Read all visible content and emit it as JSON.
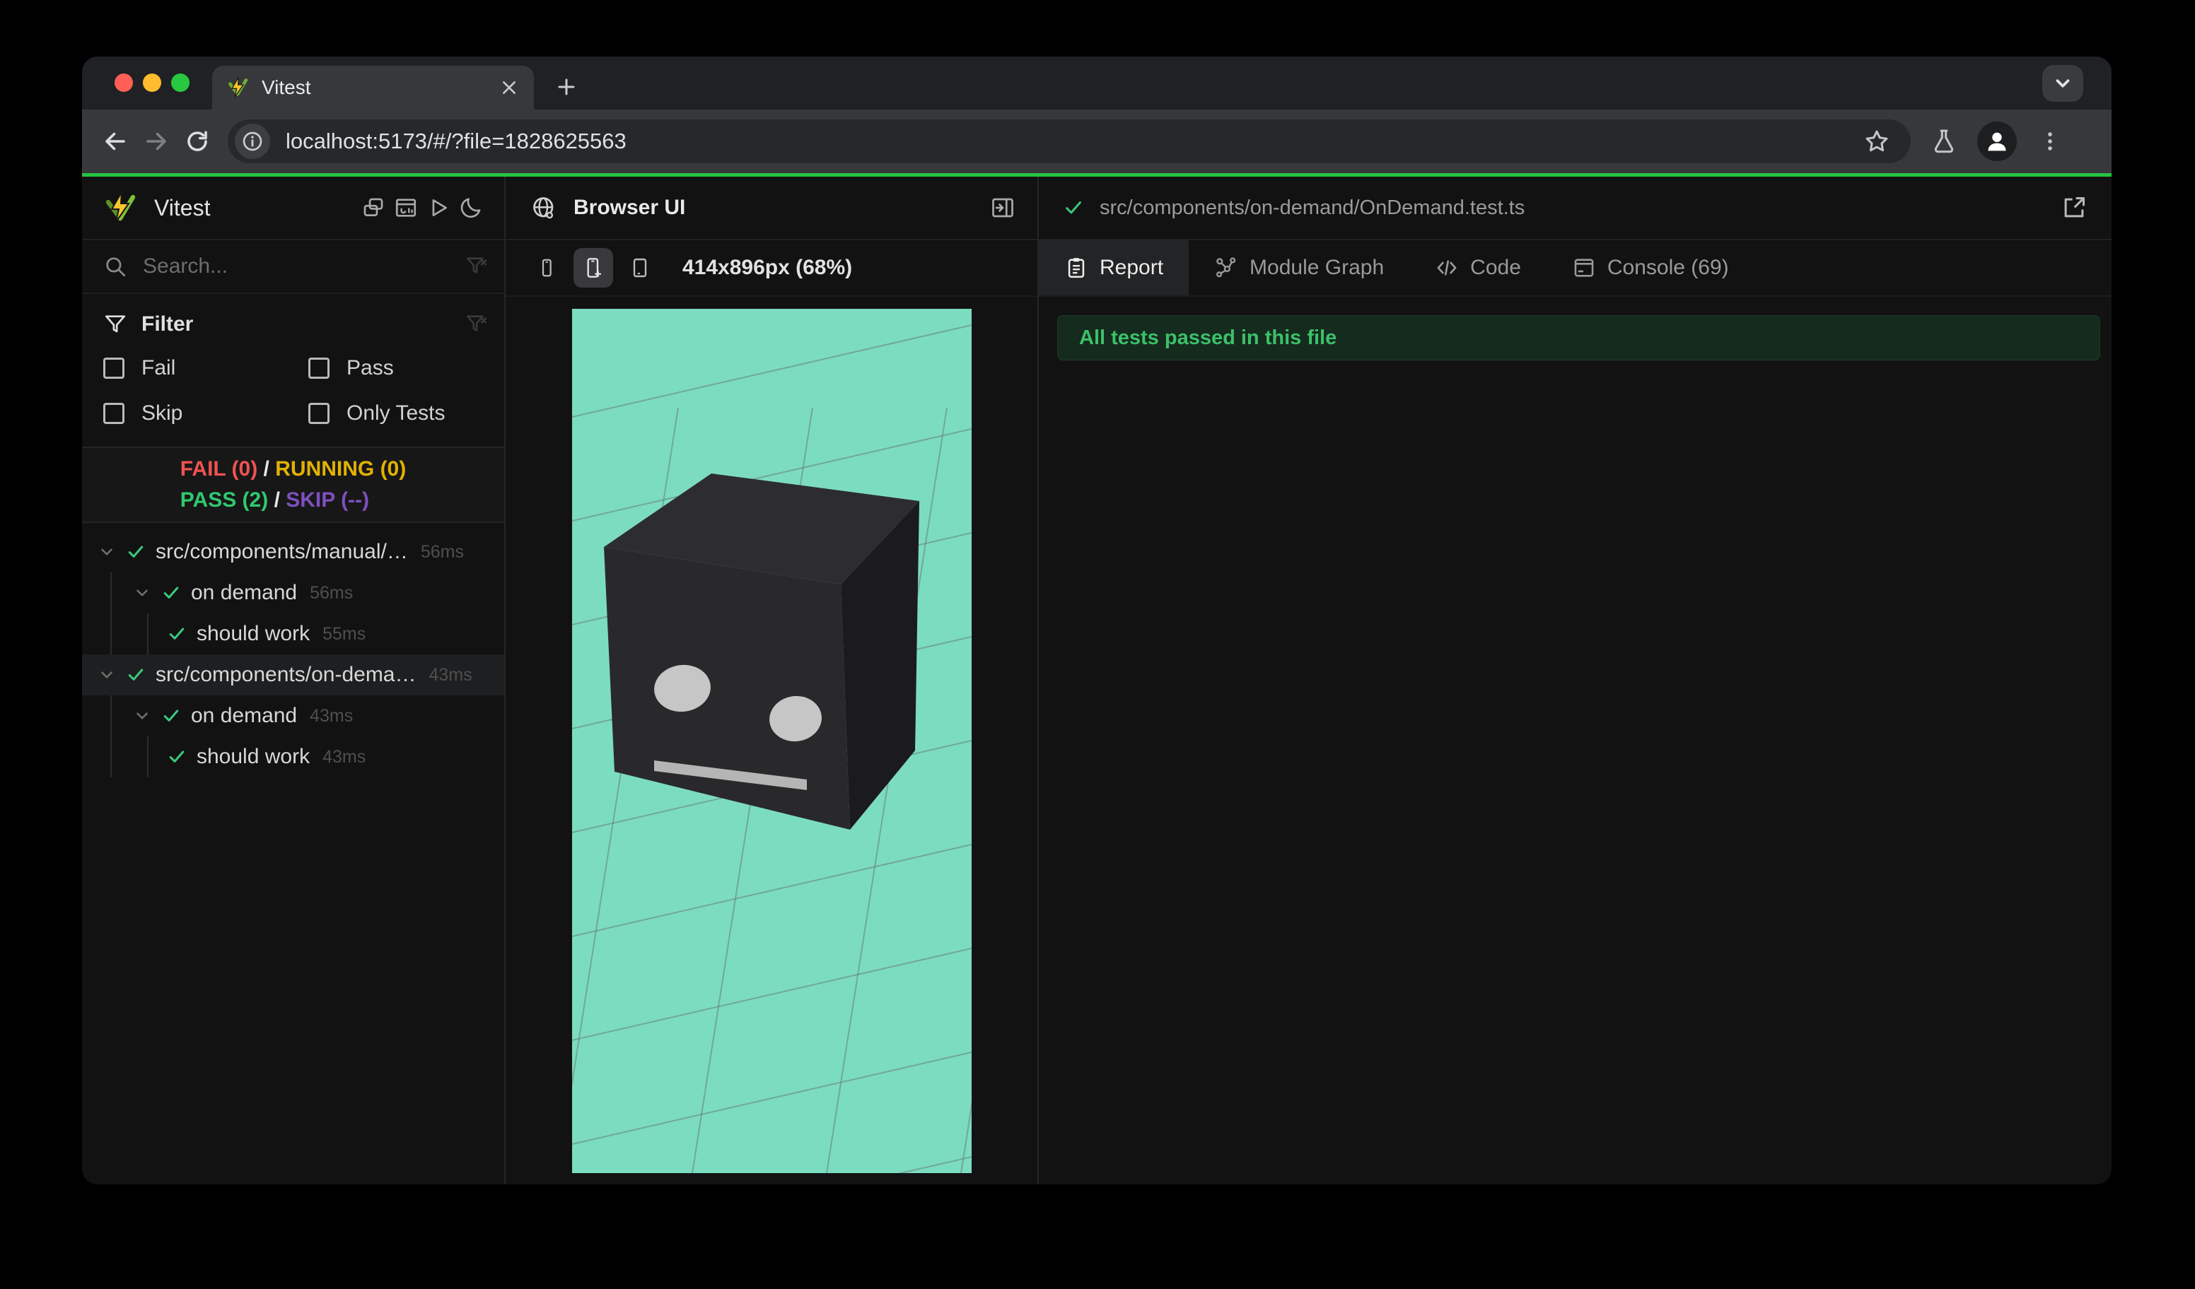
{
  "browser": {
    "tab_title": "Vitest",
    "url": "localhost:5173/#/?file=1828625563"
  },
  "sidebar": {
    "title": "Vitest",
    "search_placeholder": "Search...",
    "filter_title": "Filter",
    "filters": [
      "Fail",
      "Pass",
      "Skip",
      "Only Tests"
    ],
    "status": {
      "fail": "FAIL (0)",
      "running": "RUNNING (0)",
      "pass": "PASS (2)",
      "skip": "SKIP (--)",
      "sep": "/"
    },
    "tree": [
      {
        "label": "src/components/manual/…",
        "time": "56ms"
      },
      {
        "label": "on demand",
        "time": "56ms"
      },
      {
        "label": "should work",
        "time": "55ms"
      },
      {
        "label": "src/components/on-dema…",
        "time": "43ms"
      },
      {
        "label": "on demand",
        "time": "43ms"
      },
      {
        "label": "should work",
        "time": "43ms"
      }
    ]
  },
  "preview": {
    "title": "Browser UI",
    "viewport_label": "414x896px (68%)"
  },
  "results": {
    "file_path": "src/components/on-demand/OnDemand.test.ts",
    "tabs": [
      "Report",
      "Module Graph",
      "Code",
      "Console (69)"
    ],
    "banner": "All tests passed in this file"
  },
  "colors": {
    "accent_green": "#3cc97e",
    "fail_red": "#ef5350",
    "running_yellow": "#e2b203",
    "pass_green": "#2fc96f",
    "skip_purple": "#7e4fc0",
    "top_line_green": "#27c340",
    "canvas_teal": "#7cdcc0",
    "banner_text_green": "#3cc06a",
    "traffic_red": "#ff5f57",
    "traffic_yellow": "#febc2e",
    "traffic_green": "#28c840"
  }
}
